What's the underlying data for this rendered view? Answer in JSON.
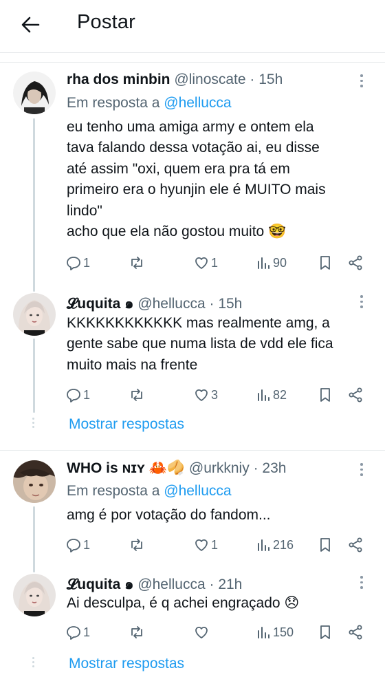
{
  "header": {
    "title": "Postar"
  },
  "posts": [
    {
      "name": "rha dos minbin",
      "handle": "@linoscate",
      "time": "15h",
      "reply_prefix": "Em resposta a",
      "reply_to": "@hellucca",
      "text": "eu tenho uma amiga army e ontem ela\ntava falando dessa votação ai, eu disse\naté assim \"oxi, quem era pra tá em\nprimeiro era o hyunjin ele é MUITO mais\nlindo\"\nacho que ela não gostou muito 🤓",
      "replies": "1",
      "reposts": "",
      "likes": "1",
      "views": "90"
    },
    {
      "name": "𝓛uquita ๑",
      "handle": "@hellucca",
      "time": "15h",
      "text": "KKKKKKKKKKKK mas realmente amg, a\ngente sabe que numa lista de vdd ele fica\nmuito mais na frente",
      "replies": "1",
      "reposts": "",
      "likes": "3",
      "views": "82"
    },
    {
      "name": "WHO is ɴɪʏ 🦀🥠",
      "handle": "@urkkniy",
      "time": "23h",
      "reply_prefix": "Em resposta a",
      "reply_to": "@hellucca",
      "text": "amg é por votação do fandom...",
      "replies": "1",
      "reposts": "",
      "likes": "1",
      "views": "216"
    },
    {
      "name": "𝓛uquita ๑",
      "handle": "@hellucca",
      "time": "21h",
      "text": "Ai desculpa, é q achei engraçado 😞",
      "replies": "1",
      "reposts": "",
      "likes": "",
      "views": "150"
    }
  ],
  "show_replies_label": "Mostrar respostas",
  "colors": {
    "accent": "#1d9bf0",
    "muted": "#536471",
    "line": "#cfd9de"
  },
  "icons": [
    "back-arrow-icon",
    "more-icon",
    "reply-icon",
    "repost-icon",
    "like-icon",
    "views-icon",
    "bookmark-icon",
    "share-icon"
  ]
}
